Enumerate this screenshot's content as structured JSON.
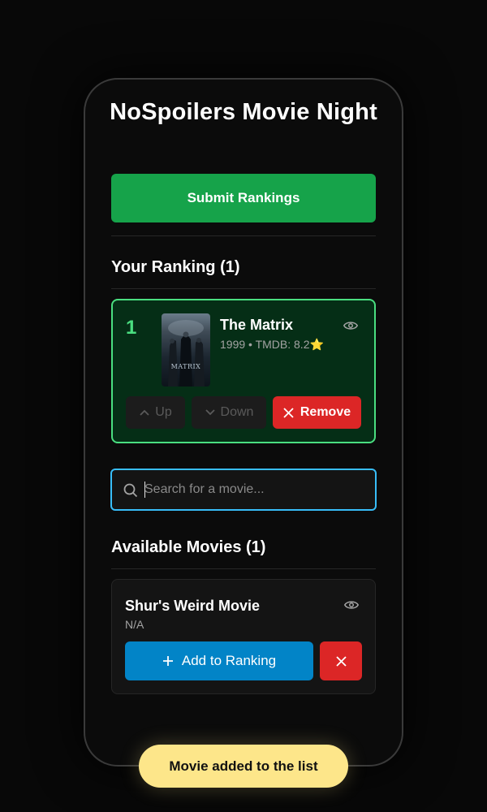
{
  "app": {
    "title": "NoSpoilers Movie Night"
  },
  "actions": {
    "submit_label": "Submit Rankings"
  },
  "ranking": {
    "heading": "Your Ranking (1)",
    "items": [
      {
        "rank": "1",
        "title": "The Matrix",
        "meta": "1999 • TMDB: 8.2⭐",
        "poster_text": "MATRIX",
        "up_label": "Up",
        "down_label": "Down",
        "remove_label": "Remove"
      }
    ]
  },
  "search": {
    "placeholder": "Search for a movie...",
    "value": ""
  },
  "available": {
    "heading": "Available Movies (1)",
    "items": [
      {
        "title": "Shur's Weird Movie",
        "meta": "N/A",
        "add_label": "Add to Ranking"
      }
    ]
  },
  "toast": {
    "message": "Movie added to the list"
  },
  "colors": {
    "primary_green": "#16a34a",
    "rank_border": "#4ade80",
    "danger": "#dc2626",
    "info": "#0284c7",
    "focus": "#38bdf8",
    "toast": "#fde68a"
  },
  "icons": [
    "eye-icon",
    "chevron-up-icon",
    "chevron-down-icon",
    "close-icon",
    "search-icon",
    "plus-icon"
  ]
}
